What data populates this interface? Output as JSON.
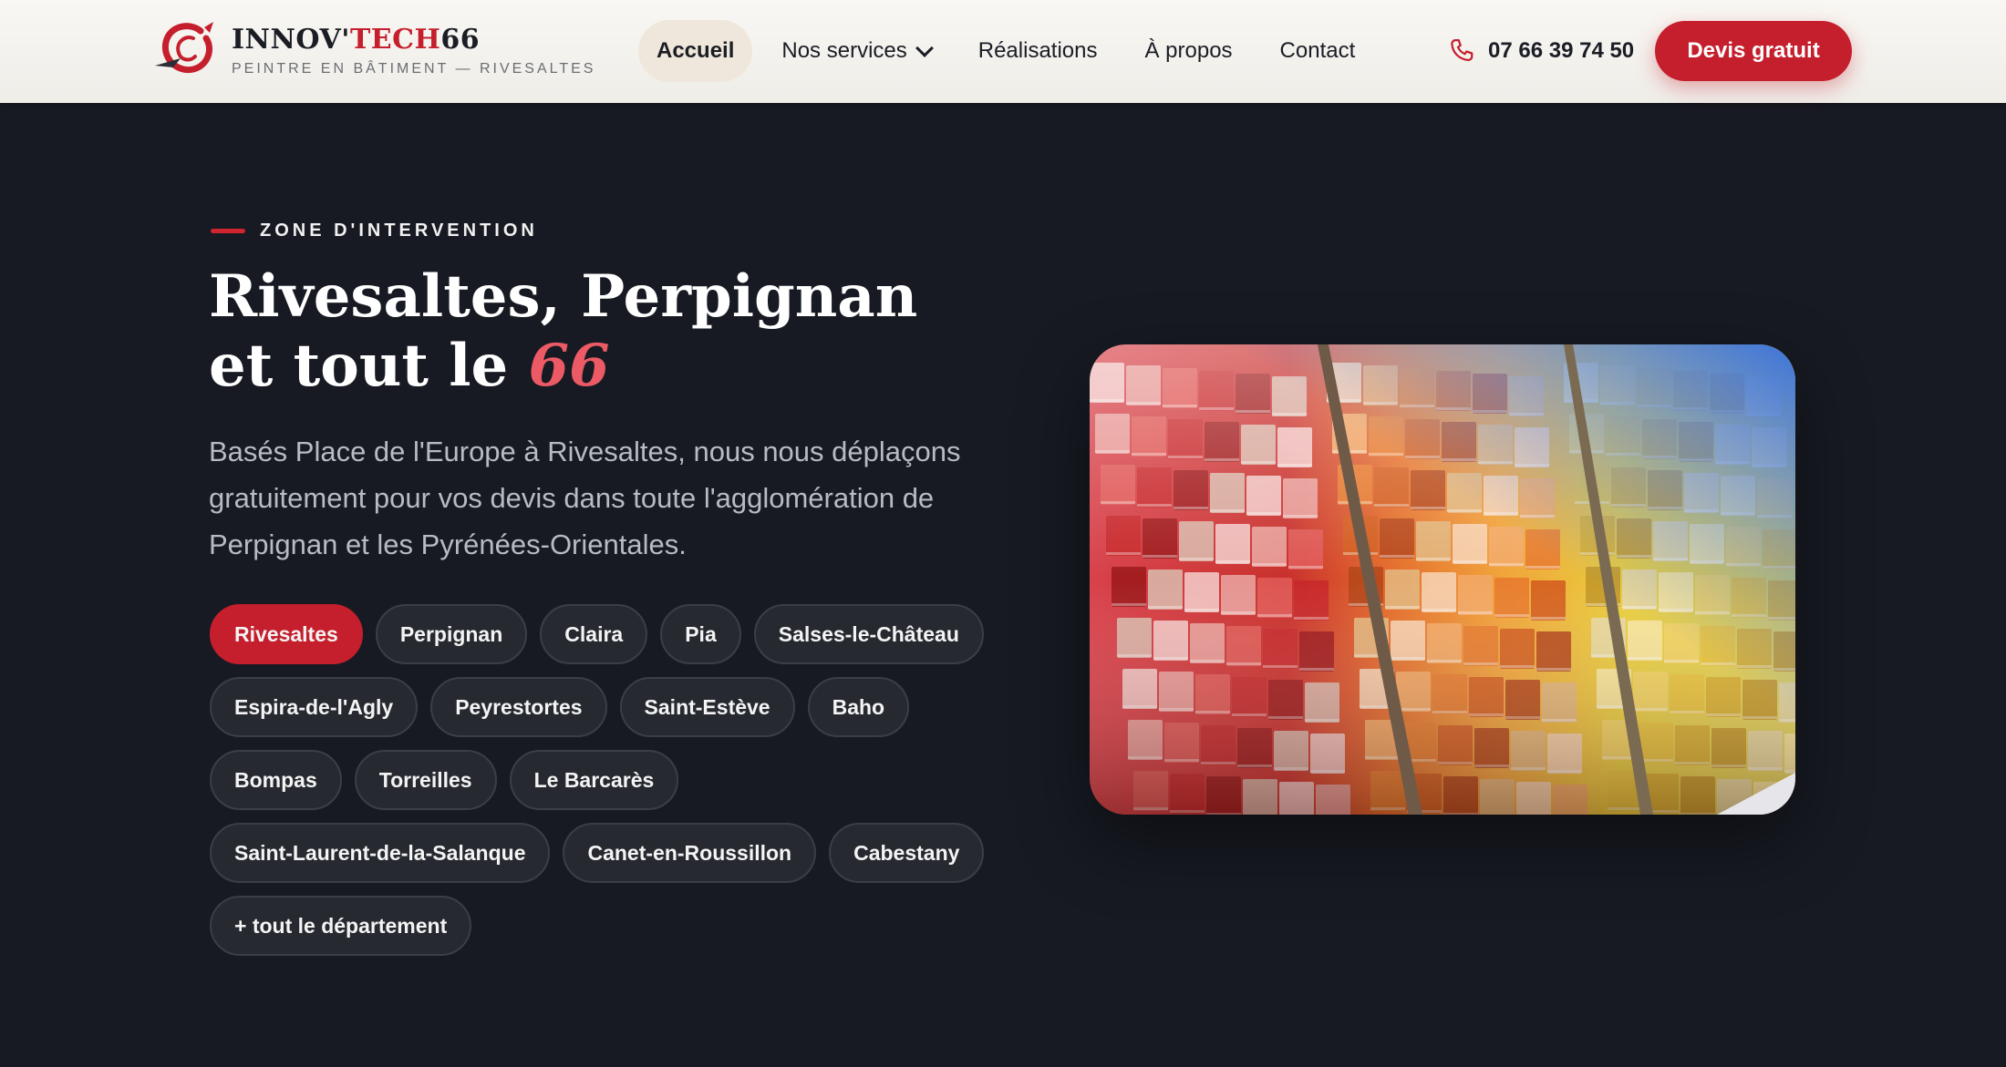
{
  "header": {
    "brand": {
      "part1": "INNOV'",
      "part2": "TECH",
      "part3": "66",
      "tagline": "PEINTRE EN BÂTIMENT — RIVESALTES"
    },
    "nav": [
      {
        "label": "Accueil",
        "active": true
      },
      {
        "label": "Nos services",
        "dropdown": true
      },
      {
        "label": "Réalisations"
      },
      {
        "label": "À propos"
      },
      {
        "label": "Contact"
      }
    ],
    "phone": "07 66 39 74 50",
    "cta": "Devis gratuit"
  },
  "hero": {
    "eyebrow": "ZONE D'INTERVENTION",
    "title_line1": "Rivesaltes, Perpignan",
    "title_line2_prefix": "et tout le ",
    "title_line2_highlight": "66",
    "lead": "Basés Place de l'Europe à Rivesaltes, nous nous déplaçons gratuitement pour vos devis dans toute l'agglomération de Perpignan et les Pyrénées-Orientales.",
    "towns": [
      "Rivesaltes",
      "Perpignan",
      "Claira",
      "Pia",
      "Salses-le-Château",
      "Espira-de-l'Agly",
      "Peyrestortes",
      "Saint-Estève",
      "Baho",
      "Bompas",
      "Torreilles",
      "Le Barcarès",
      "Saint-Laurent-de-la-Salanque",
      "Canet-en-Roussillon",
      "Cabestany",
      "+ tout le département"
    ],
    "image": "paint-swatch-display-photo"
  },
  "colors": {
    "accent": "#c51f2d",
    "background": "#171a22",
    "highlight": "#ec5a66"
  }
}
